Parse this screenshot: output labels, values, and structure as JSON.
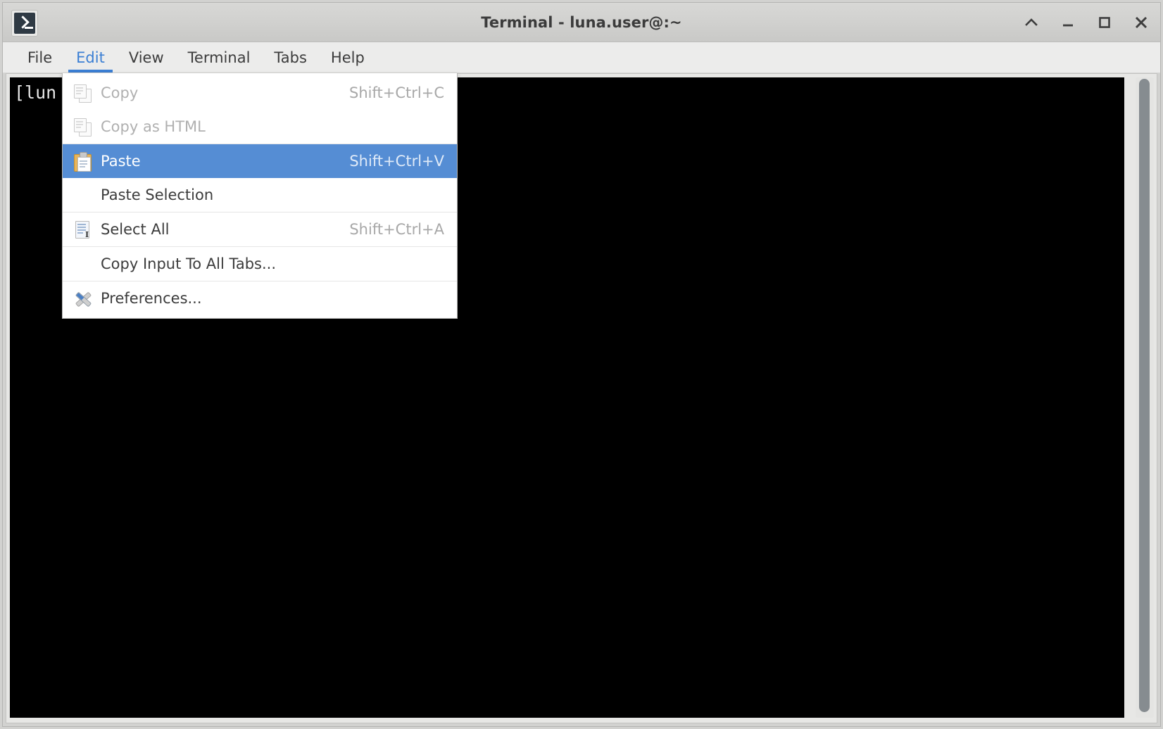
{
  "window": {
    "title": "Terminal - luna.user@:~",
    "app_icon": "terminal-prompt-icon",
    "controls": [
      {
        "name": "shade-button",
        "icon": "chevron-up-icon",
        "label": "Shade"
      },
      {
        "name": "minimize-button",
        "icon": "minimize-icon",
        "label": "Minimize"
      },
      {
        "name": "maximize-button",
        "icon": "maximize-icon",
        "label": "Maximize"
      },
      {
        "name": "close-button",
        "icon": "close-icon",
        "label": "Close"
      }
    ]
  },
  "menubar": {
    "items": [
      {
        "label": "File",
        "active": false
      },
      {
        "label": "Edit",
        "active": true
      },
      {
        "label": "View",
        "active": false
      },
      {
        "label": "Terminal",
        "active": false
      },
      {
        "label": "Tabs",
        "active": false
      },
      {
        "label": "Help",
        "active": false
      }
    ],
    "accent_color": "#3b7fd4"
  },
  "edit_menu": {
    "open": true,
    "highlight_color": "#558dd4",
    "items": [
      {
        "label": "Copy",
        "accel": "Shift+Ctrl+C",
        "icon": "copy-icon",
        "state": "disabled",
        "separator_after": false
      },
      {
        "label": "Copy as HTML",
        "accel": "",
        "icon": "copy-icon",
        "state": "disabled",
        "separator_after": true
      },
      {
        "label": "Paste",
        "accel": "Shift+Ctrl+V",
        "icon": "paste-icon",
        "state": "highlighted",
        "separator_after": false
      },
      {
        "label": "Paste Selection",
        "accel": "",
        "icon": "",
        "state": "normal",
        "separator_after": true
      },
      {
        "label": "Select All",
        "accel": "Shift+Ctrl+A",
        "icon": "select-all-icon",
        "state": "normal",
        "separator_after": true
      },
      {
        "label": "Copy Input To All Tabs...",
        "accel": "",
        "icon": "",
        "state": "normal",
        "separator_after": true
      },
      {
        "label": "Preferences...",
        "accel": "",
        "icon": "preferences-icon",
        "state": "normal",
        "separator_after": false
      }
    ]
  },
  "terminal": {
    "background": "#000000",
    "foreground": "#e6e6e6",
    "lines": [
      "[lun"
    ],
    "scrollbar": {
      "name": "vertical-scrollbar",
      "thumb_position_percent": 0,
      "thumb_size_percent": 99
    }
  }
}
